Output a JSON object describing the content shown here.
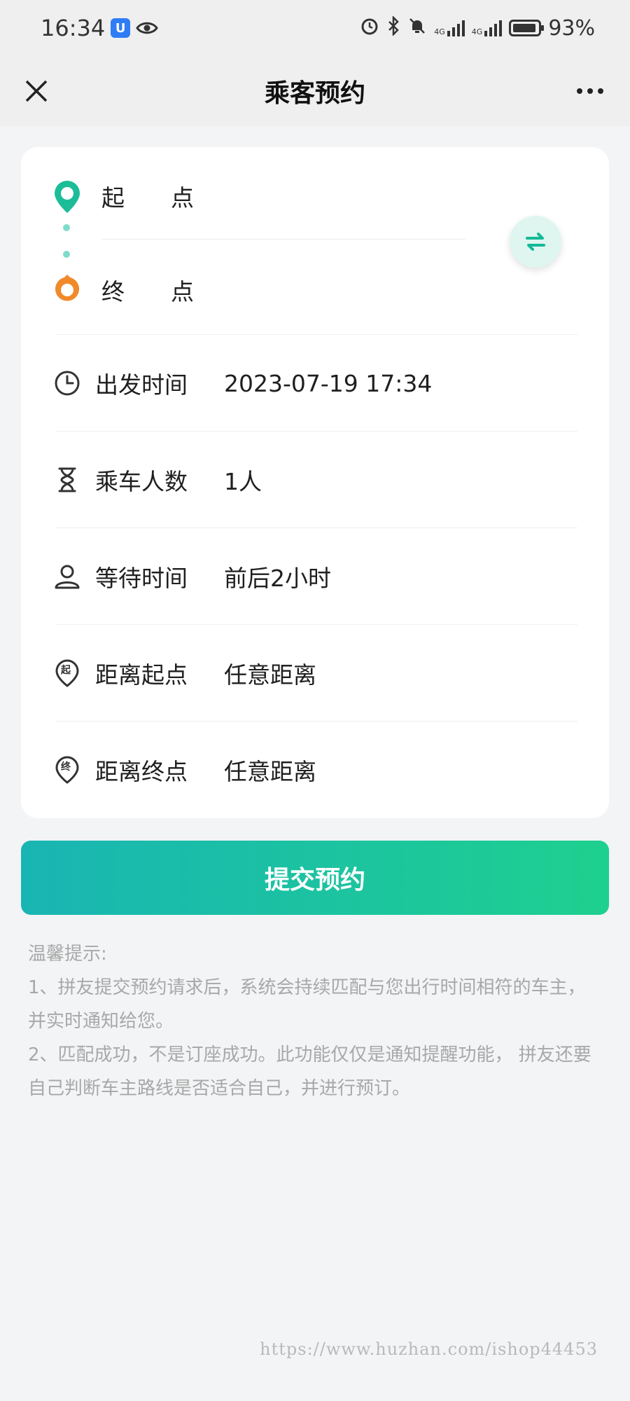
{
  "status_bar": {
    "time": "16:34",
    "battery_percent": "93%",
    "signal_1": "4G",
    "signal_2": "4G"
  },
  "header": {
    "title": "乘客预约"
  },
  "route": {
    "start_label": "起　　点",
    "end_label": "终　　点"
  },
  "rows": [
    {
      "label": "出发时间",
      "value": "2023-07-19 17:34"
    },
    {
      "label": "乘车人数",
      "value": "1人"
    },
    {
      "label": "等待时间",
      "value": "前后2小时"
    },
    {
      "label": "距离起点",
      "value": "任意距离",
      "badge": "起"
    },
    {
      "label": "距离终点",
      "value": "任意距离",
      "badge": "终"
    }
  ],
  "submit_label": "提交预约",
  "tips": {
    "title": "温馨提示:",
    "line1": "1、拼友提交预约请求后，系统会持续匹配与您出行时间相符的车主，并实时通知给您。",
    "line2": "2、匹配成功，不是订座成功。此功能仅仅是通知提醒功能， 拼友还要自己判断车主路线是否适合自己，并进行预订。"
  },
  "watermark": "https://www.huzhan.com/ishop44453",
  "colors": {
    "accent_teal": "#19b5b3",
    "accent_green": "#1ed08f",
    "start_pin": "#1bbd98",
    "end_pin": "#f08a2a"
  }
}
